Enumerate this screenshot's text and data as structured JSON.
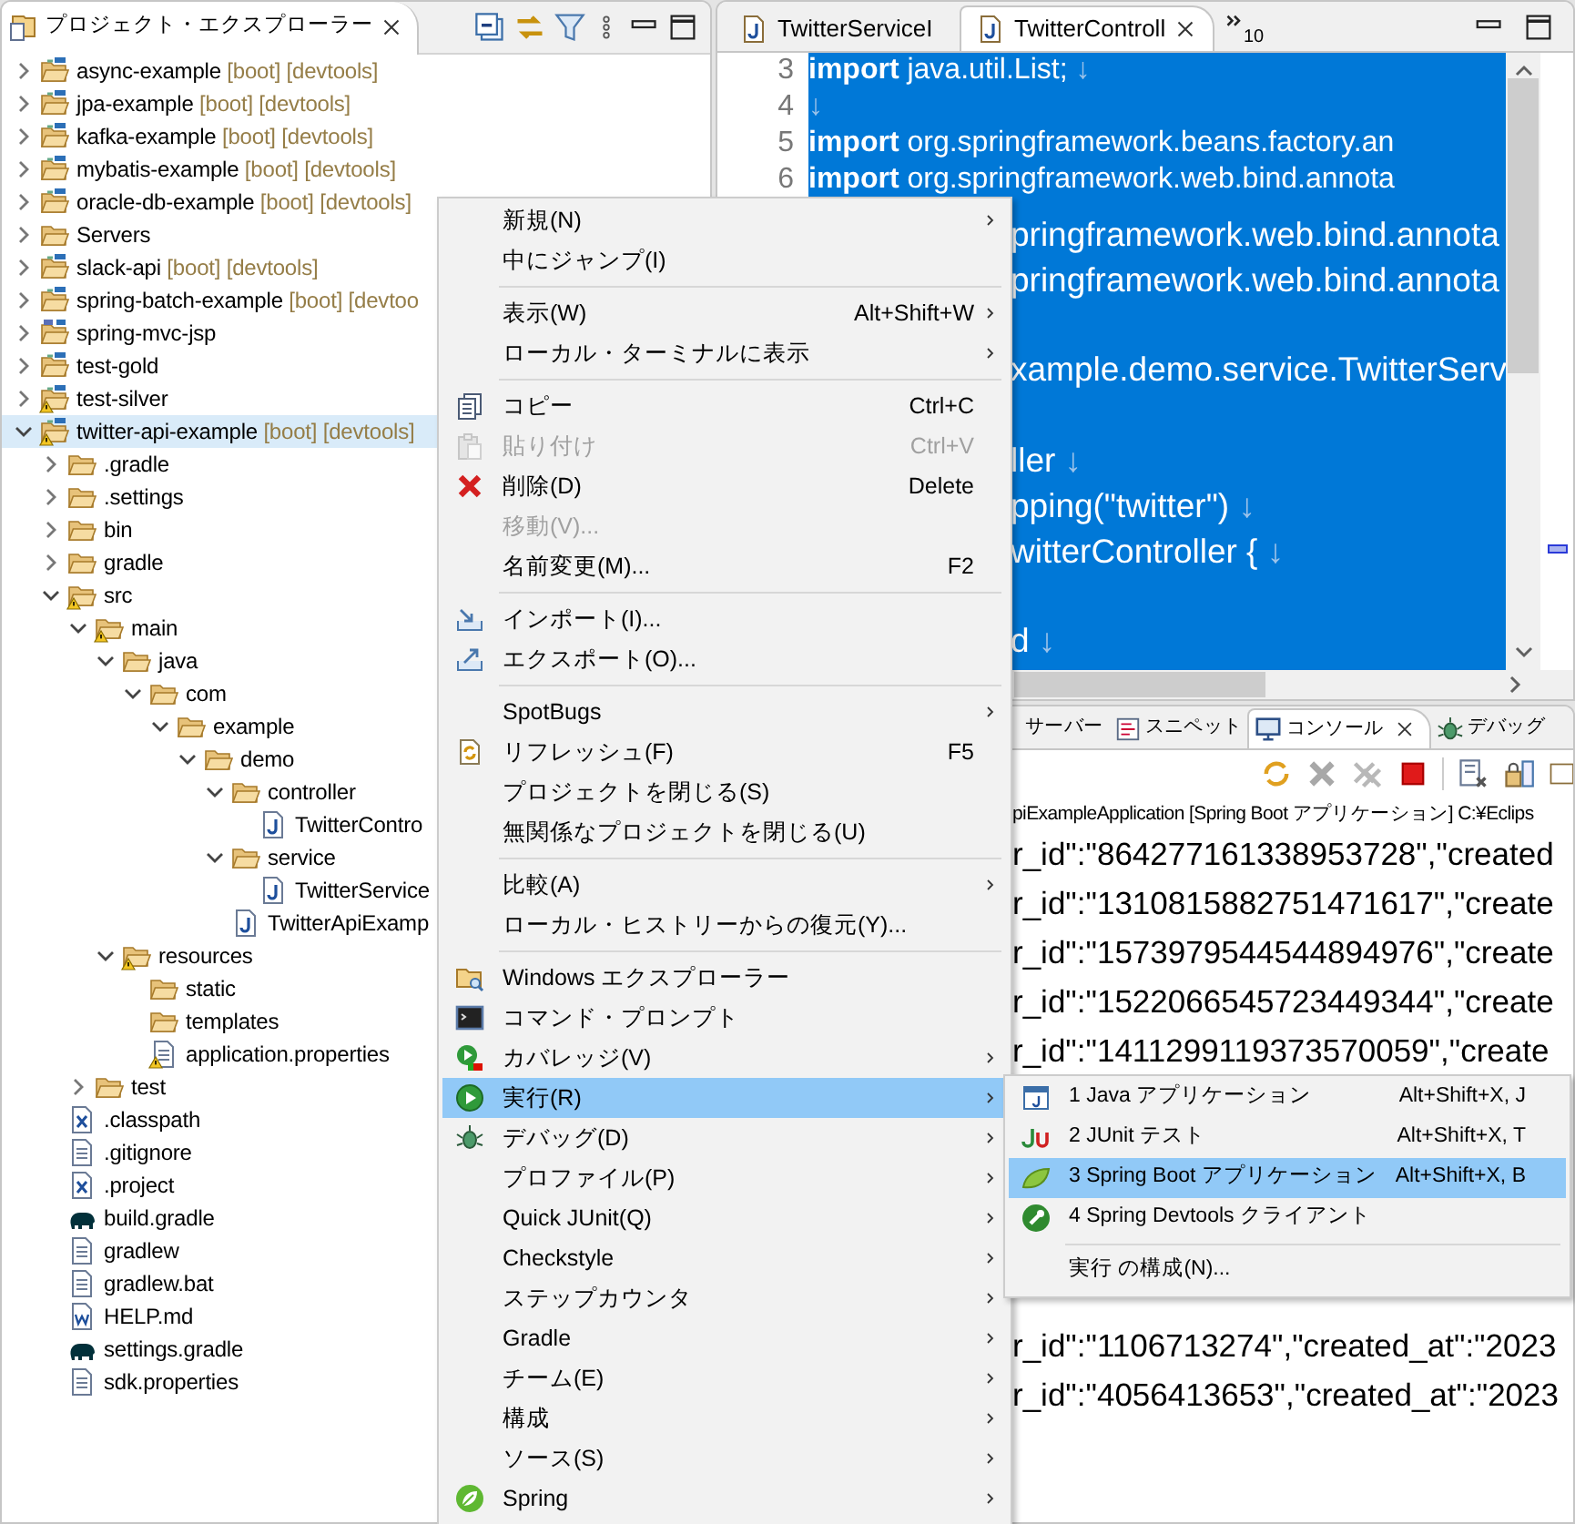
{
  "explorer": {
    "title": "プロジェクト・エクスプローラー",
    "tree": [
      {
        "label": "async-example",
        "decoration": "[boot] [devtools]",
        "kind": "project",
        "expanded": false,
        "selected": false,
        "warning": false
      },
      {
        "label": "jpa-example",
        "decoration": "[boot] [devtools]",
        "kind": "project",
        "expanded": false,
        "selected": false,
        "warning": false
      },
      {
        "label": "kafka-example",
        "decoration": "[boot] [devtools]",
        "kind": "project",
        "expanded": false,
        "selected": false,
        "warning": false
      },
      {
        "label": "mybatis-example",
        "decoration": "[boot] [devtools]",
        "kind": "project",
        "expanded": false,
        "selected": false,
        "warning": false
      },
      {
        "label": "oracle-db-example",
        "decoration": "[boot] [devtools]",
        "kind": "project",
        "expanded": false,
        "selected": false,
        "warning": false
      },
      {
        "label": "Servers",
        "kind": "folder",
        "expanded": false,
        "selected": false,
        "warning": false
      },
      {
        "label": "slack-api",
        "decoration": "[boot] [devtools]",
        "kind": "project",
        "expanded": false,
        "selected": false,
        "warning": false
      },
      {
        "label": "spring-batch-example",
        "decoration": "[boot] [devtoo",
        "kind": "project",
        "expanded": false,
        "selected": false,
        "warning": false
      },
      {
        "label": "spring-mvc-jsp",
        "kind": "web-project",
        "expanded": false,
        "selected": false,
        "warning": false
      },
      {
        "label": "test-gold",
        "kind": "project",
        "expanded": false,
        "selected": false,
        "warning": false
      },
      {
        "label": "test-silver",
        "kind": "project",
        "expanded": false,
        "selected": false,
        "warning": true
      },
      {
        "label": "twitter-api-example",
        "decoration": "[boot] [devtools]",
        "kind": "project",
        "expanded": true,
        "selected": true,
        "warning": true,
        "children": [
          {
            "label": ".gradle",
            "kind": "folder",
            "expanded": false,
            "selected": false,
            "warning": false
          },
          {
            "label": ".settings",
            "kind": "folder",
            "expanded": false,
            "selected": false,
            "warning": false
          },
          {
            "label": "bin",
            "kind": "folder",
            "expanded": false,
            "selected": false,
            "warning": false
          },
          {
            "label": "gradle",
            "kind": "folder",
            "expanded": false,
            "selected": false,
            "warning": false
          },
          {
            "label": "src",
            "kind": "folder",
            "expanded": true,
            "selected": false,
            "warning": true,
            "children": [
              {
                "label": "main",
                "kind": "folder",
                "expanded": true,
                "selected": false,
                "warning": true,
                "children": [
                  {
                    "label": "java",
                    "kind": "folder",
                    "expanded": true,
                    "selected": false,
                    "warning": false,
                    "children": [
                      {
                        "label": "com",
                        "kind": "folder",
                        "expanded": true,
                        "selected": false,
                        "warning": false,
                        "children": [
                          {
                            "label": "example",
                            "kind": "folder",
                            "expanded": true,
                            "selected": false,
                            "warning": false,
                            "children": [
                              {
                                "label": "demo",
                                "kind": "folder",
                                "expanded": true,
                                "selected": false,
                                "warning": false,
                                "children": [
                                  {
                                    "label": "controller",
                                    "kind": "folder",
                                    "expanded": true,
                                    "selected": false,
                                    "warning": false,
                                    "children": [
                                      {
                                        "label": "TwitterContro",
                                        "kind": "java",
                                        "selected": false,
                                        "warning": false
                                      }
                                    ]
                                  },
                                  {
                                    "label": "service",
                                    "kind": "folder",
                                    "expanded": true,
                                    "selected": false,
                                    "warning": false,
                                    "children": [
                                      {
                                        "label": "TwitterService",
                                        "kind": "java",
                                        "selected": false,
                                        "warning": false
                                      }
                                    ]
                                  },
                                  {
                                    "label": "TwitterApiExamp",
                                    "kind": "java",
                                    "selected": false,
                                    "warning": false
                                  }
                                ]
                              }
                            ]
                          }
                        ]
                      }
                    ]
                  },
                  {
                    "label": "resources",
                    "kind": "folder",
                    "expanded": true,
                    "selected": false,
                    "warning": true,
                    "children": [
                      {
                        "label": "static",
                        "kind": "folder",
                        "selected": false,
                        "warning": false
                      },
                      {
                        "label": "templates",
                        "kind": "folder",
                        "selected": false,
                        "warning": false
                      },
                      {
                        "label": "application.properties",
                        "kind": "file",
                        "selected": false,
                        "warning": true
                      }
                    ]
                  }
                ]
              },
              {
                "label": "test",
                "kind": "folder",
                "expanded": false,
                "selected": false,
                "warning": false
              }
            ]
          },
          {
            "label": ".classpath",
            "kind": "xml",
            "selected": false,
            "warning": false
          },
          {
            "label": ".gitignore",
            "kind": "file",
            "selected": false,
            "warning": false
          },
          {
            "label": ".project",
            "kind": "xml",
            "selected": false,
            "warning": false
          },
          {
            "label": "build.gradle",
            "kind": "gradle",
            "selected": false,
            "warning": false
          },
          {
            "label": "gradlew",
            "kind": "file",
            "selected": false,
            "warning": false
          },
          {
            "label": "gradlew.bat",
            "kind": "file",
            "selected": false,
            "warning": false
          },
          {
            "label": "HELP.md",
            "kind": "word",
            "selected": false,
            "warning": false
          },
          {
            "label": "settings.gradle",
            "kind": "gradle",
            "selected": false,
            "warning": false
          },
          {
            "label": "sdk.properties",
            "kind": "file",
            "selected": false,
            "warning": false
          }
        ]
      }
    ]
  },
  "editor": {
    "tabs": [
      {
        "label": "TwitterServiceI",
        "selected": false
      },
      {
        "label": "TwitterControll",
        "selected": true
      }
    ],
    "overflow_count": "10",
    "lines": [
      {
        "kind": "full",
        "number": "3",
        "text": "**import** java.util.List;",
        "eol": "↓"
      },
      {
        "kind": "full",
        "number": "4",
        "eol": "↓"
      },
      {
        "kind": "full",
        "number": "5",
        "text": "**import** org.springframework.beans.factory.an"
      },
      {
        "kind": "full",
        "number": "6",
        "text": "**import** org.springframework.web.bind.annota"
      },
      {
        "kind": "partial",
        "text": "pringframework.web.bind.annota"
      },
      {
        "kind": "partial",
        "text": "pringframework.web.bind.annota"
      },
      {
        "kind": "partial"
      },
      {
        "kind": "partial",
        "text": "xample.demo.service.TwitterServ"
      },
      {
        "kind": "partial"
      },
      {
        "kind": "partial",
        "text": "ller",
        "eol": "↓"
      },
      {
        "kind": "partial",
        "text": "pping(\"twitter\")",
        "eol": "↓"
      },
      {
        "kind": "partial",
        "text": "witterController {",
        "eol": "↓"
      },
      {
        "kind": "partial"
      },
      {
        "kind": "partial",
        "text": "d",
        "eol": "↓"
      }
    ]
  },
  "console": {
    "tabs": [
      {
        "label": "サーバー",
        "kind": "server",
        "selected": false
      },
      {
        "label": "スニペット",
        "kind": "snippet",
        "selected": false
      },
      {
        "label": "コンソール",
        "kind": "console",
        "selected": true
      },
      {
        "label": "デバッグ",
        "kind": "debug",
        "selected": false
      }
    ],
    "header": "piExampleApplication [Spring Boot アプリケーション] C:¥Eclips",
    "lines": [
      "r_id\":\"864277161338953728\",\"created",
      "r_id\":\"1310815882751471617\",\"create",
      "r_id\":\"1573979544544894976\",\"create",
      "r_id\":\"1522066545723449344\",\"create",
      "r_id\":\"1411299119373570059\",\"create",
      "r_id\":\"1106713274\",\"created_at\":\"2023",
      "r_id\":\"4056413653\",\"created_at\":\"2023"
    ]
  },
  "context_menu": {
    "items": [
      {
        "kind": "item",
        "label": "新規(N)",
        "submenu": true,
        "disabled": false,
        "selected": false
      },
      {
        "kind": "item",
        "label": "中にジャンプ(I)",
        "submenu": false,
        "disabled": false,
        "selected": false
      },
      {
        "kind": "separator"
      },
      {
        "kind": "item",
        "label": "表示(W)",
        "shortcut": "Alt+Shift+W",
        "submenu": true,
        "disabled": false,
        "selected": false
      },
      {
        "kind": "item",
        "label": "ローカル・ターミナルに表示",
        "submenu": true,
        "disabled": false,
        "selected": false
      },
      {
        "kind": "separator"
      },
      {
        "kind": "copy",
        "label": "コピー",
        "shortcut": "Ctrl+C",
        "submenu": false,
        "disabled": false,
        "selected": false
      },
      {
        "kind": "paste",
        "label": "貼り付け",
        "shortcut": "Ctrl+V",
        "submenu": false,
        "disabled": true,
        "selected": false
      },
      {
        "kind": "delete",
        "label": "削除(D)",
        "shortcut": "Delete",
        "submenu": false,
        "disabled": false,
        "selected": false
      },
      {
        "kind": "item",
        "label": "移動(V)...",
        "submenu": false,
        "disabled": true,
        "selected": false
      },
      {
        "kind": "item",
        "label": "名前変更(M)...",
        "shortcut": "F2",
        "submenu": false,
        "disabled": false,
        "selected": false
      },
      {
        "kind": "separator"
      },
      {
        "kind": "import",
        "label": "インポート(I)...",
        "submenu": false,
        "disabled": false,
        "selected": false
      },
      {
        "kind": "export",
        "label": "エクスポート(O)...",
        "submenu": false,
        "disabled": false,
        "selected": false
      },
      {
        "kind": "separator"
      },
      {
        "kind": "item",
        "label": "SpotBugs",
        "submenu": true,
        "disabled": false,
        "selected": false
      },
      {
        "kind": "refresh",
        "label": "リフレッシュ(F)",
        "shortcut": "F5",
        "submenu": false,
        "disabled": false,
        "selected": false
      },
      {
        "kind": "item",
        "label": "プロジェクトを閉じる(S)",
        "submenu": false,
        "disabled": false,
        "selected": false
      },
      {
        "kind": "item",
        "label": "無関係なプロジェクトを閉じる(U)",
        "submenu": false,
        "disabled": false,
        "selected": false
      },
      {
        "kind": "separator"
      },
      {
        "kind": "item",
        "label": "比較(A)",
        "submenu": true,
        "disabled": false,
        "selected": false
      },
      {
        "kind": "item",
        "label": "ローカル・ヒストリーからの復元(Y)...",
        "submenu": false,
        "disabled": false,
        "selected": false
      },
      {
        "kind": "separator"
      },
      {
        "kind": "explorer",
        "label": "Windows エクスプローラー",
        "submenu": false,
        "disabled": false,
        "selected": false
      },
      {
        "kind": "terminal",
        "label": "コマンド・プロンプト",
        "submenu": false,
        "disabled": false,
        "selected": false
      },
      {
        "kind": "coverage",
        "label": "カバレッジ(V)",
        "submenu": true,
        "disabled": false,
        "selected": false
      },
      {
        "kind": "run",
        "label": "実行(R)",
        "submenu": true,
        "disabled": false,
        "selected": true
      },
      {
        "kind": "bug",
        "label": "デバッグ(D)",
        "submenu": true,
        "disabled": false,
        "selected": false
      },
      {
        "kind": "item",
        "label": "プロファイル(P)",
        "submenu": true,
        "disabled": false,
        "selected": false
      },
      {
        "kind": "item",
        "label": "Quick JUnit(Q)",
        "submenu": true,
        "disabled": false,
        "selected": false
      },
      {
        "kind": "item",
        "label": "Checkstyle",
        "submenu": true,
        "disabled": false,
        "selected": false
      },
      {
        "kind": "item",
        "label": "ステップカウンタ",
        "submenu": true,
        "disabled": false,
        "selected": false
      },
      {
        "kind": "item",
        "label": "Gradle",
        "submenu": true,
        "disabled": false,
        "selected": false
      },
      {
        "kind": "item",
        "label": "チーム(E)",
        "submenu": true,
        "disabled": false,
        "selected": false
      },
      {
        "kind": "item",
        "label": "構成",
        "submenu": true,
        "disabled": false,
        "selected": false
      },
      {
        "kind": "item",
        "label": "ソース(S)",
        "submenu": true,
        "disabled": false,
        "selected": false
      },
      {
        "kind": "spring",
        "label": "Spring",
        "submenu": true,
        "disabled": false,
        "selected": false
      }
    ]
  },
  "submenu": {
    "items": [
      {
        "kind": "java-app",
        "label": "1 Java アプリケーション",
        "shortcut": "Alt+Shift+X, J",
        "selected": false
      },
      {
        "kind": "junit",
        "label": "2 JUnit テスト",
        "shortcut": "Alt+Shift+X, T",
        "selected": false
      },
      {
        "kind": "leaf",
        "label": "3 Spring Boot アプリケーション",
        "shortcut": "Alt+Shift+X, B",
        "selected": true
      },
      {
        "kind": "devtools",
        "label": "4 Spring Devtools クライアント",
        "selected": false
      },
      {
        "kind": "separator"
      },
      {
        "kind": "item",
        "label": "実行 の構成(N)...",
        "selected": false
      }
    ]
  }
}
